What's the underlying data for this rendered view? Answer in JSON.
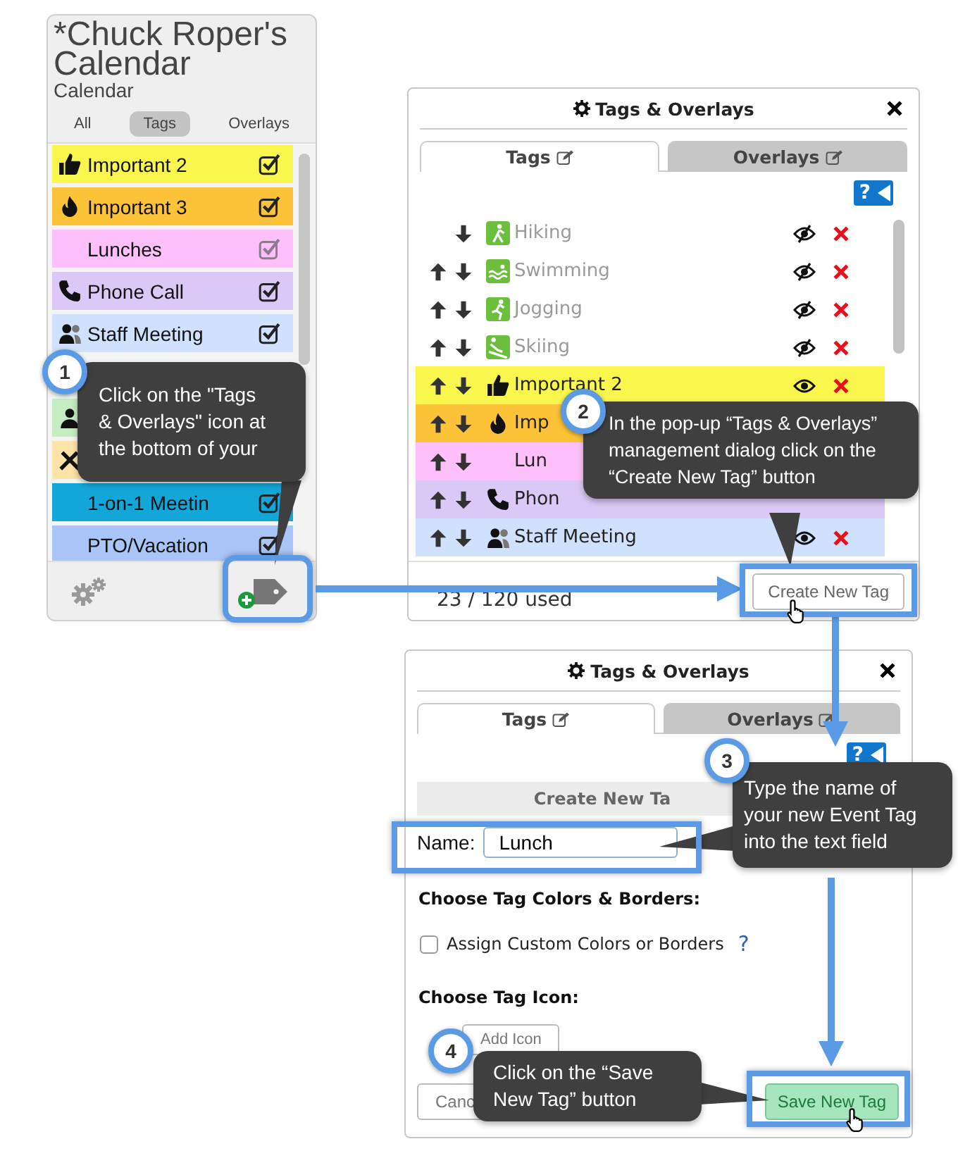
{
  "sidebar": {
    "title": "*Chuck Roper's Calendar",
    "subtitle": "Calendar",
    "tabs": [
      {
        "label": "All",
        "selected": false
      },
      {
        "label": "Tags",
        "selected": true
      },
      {
        "label": "Overlays",
        "selected": false
      }
    ],
    "tags": [
      {
        "label": "Important 2",
        "kind": "thumb",
        "color": "#f9f74d",
        "checked": true,
        "faded": false
      },
      {
        "label": "Important 3",
        "kind": "fire",
        "color": "#fcc238",
        "checked": true,
        "faded": false
      },
      {
        "label": "Lunches",
        "kind": "plain",
        "color": "#fdc0fb",
        "checked": true,
        "faded": true
      },
      {
        "label": "Phone Call",
        "kind": "phone",
        "color": "#dcc8f7",
        "checked": true,
        "faded": false
      },
      {
        "label": "Staff Meeting",
        "kind": "people",
        "color": "#cfe1fc",
        "checked": true,
        "faded": false
      },
      {
        "kind": "person",
        "color": "#c5ecc2"
      },
      {
        "kind": "tools",
        "color": "#fde3a8"
      },
      {
        "label": "1-on-1 Meetin",
        "kind": "plain",
        "color": "#13a6d9",
        "checked": true,
        "faded": false
      },
      {
        "label": "PTO/Vacation",
        "kind": "plain",
        "color": "#a9c5f8",
        "checked": true,
        "faded": false
      }
    ]
  },
  "dialog": {
    "title": "Tags & Overlays",
    "tabs": [
      {
        "label": "Tags",
        "selected": true
      },
      {
        "label": "Overlays",
        "selected": false
      }
    ],
    "help": "?",
    "tags": [
      {
        "label": "Hiking",
        "kind": "hiking",
        "color": "#ffffff",
        "hidden": true,
        "can_move_up": false
      },
      {
        "label": "Swimming",
        "kind": "swimming",
        "color": "#ffffff",
        "hidden": true,
        "can_move_up": true
      },
      {
        "label": "Jogging",
        "kind": "jogging",
        "color": "#ffffff",
        "hidden": true,
        "can_move_up": true
      },
      {
        "label": "Skiing",
        "kind": "skiing",
        "color": "#ffffff",
        "hidden": true,
        "can_move_up": true
      },
      {
        "label": "Important 2",
        "kind": "thumb",
        "color": "#f9f74d",
        "hidden": false,
        "can_move_up": true
      },
      {
        "label": "Imp",
        "kind": "fire",
        "color": "#fcc238",
        "can_move_up": true
      },
      {
        "label": "Lun",
        "kind": "plain",
        "color": "#fdc0fb",
        "can_move_up": true
      },
      {
        "label": "Phon",
        "kind": "phone",
        "color": "#dcc8f7",
        "can_move_up": true
      },
      {
        "label": "Staff Meeting",
        "kind": "people",
        "color": "#cfe1fc",
        "hidden": false,
        "can_move_up": true
      }
    ],
    "usage": "23 / 120 used",
    "create_button": "Create New Tag"
  },
  "create_dialog": {
    "title": "Tags & Overlays",
    "tabs": [
      {
        "label": "Tags",
        "selected": true
      },
      {
        "label": "Overlays",
        "selected": false
      }
    ],
    "help": "?",
    "header": "Create New Ta",
    "name_label": "Name:",
    "name_value": "Lunch",
    "colors_heading": "Choose Tag Colors & Borders:",
    "custom_colors": {
      "label": "Assign Custom Colors or Borders",
      "checked": false,
      "help": "?"
    },
    "icon_heading": "Choose Tag Icon:",
    "add_icon_button": "Add Icon",
    "cancel_button": "Canc",
    "save_button": "Save New Tag"
  },
  "callouts": [
    {
      "number": "1",
      "text": "Click on the \"Tags & Overlays\" icon at the bottom of your"
    },
    {
      "number": "2",
      "text": "In the pop-up “Tags & Overlays” management dialog click on the “Create New Tag” button"
    },
    {
      "number": "3",
      "text": "Type the name of your new Event Tag into the text field"
    },
    {
      "number": "4",
      "text": "Click on the “Save New Tag” button"
    }
  ]
}
